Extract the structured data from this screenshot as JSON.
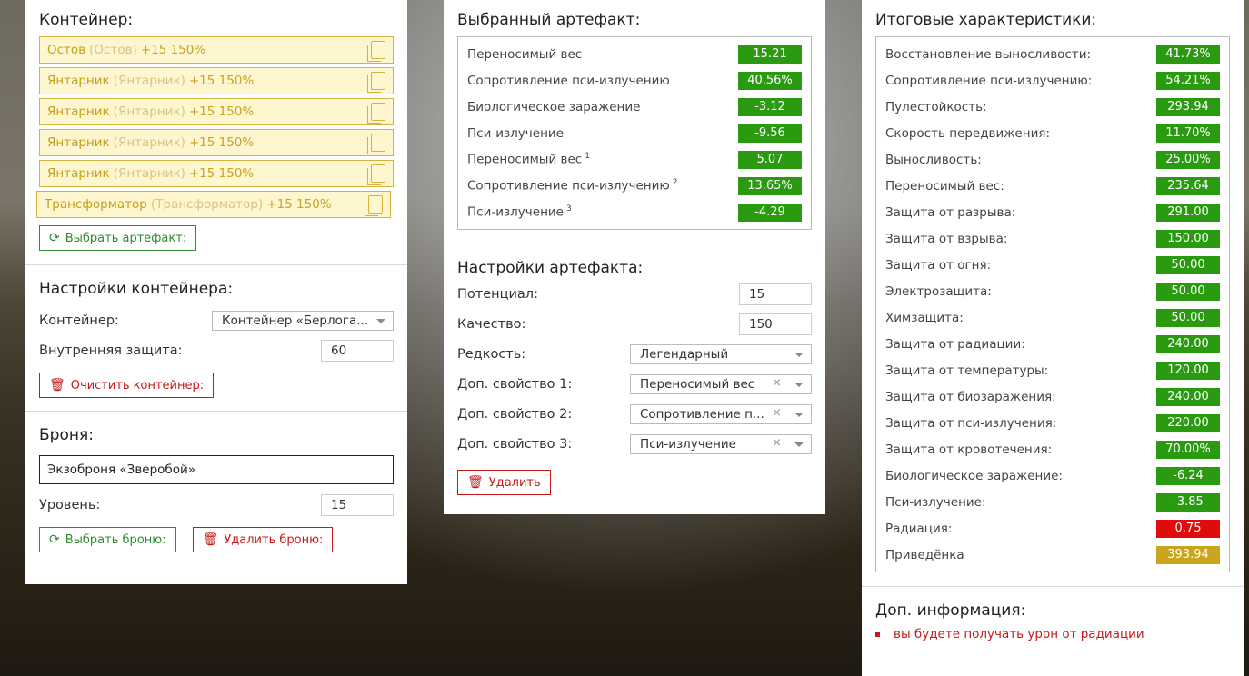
{
  "left": {
    "container_title": "Контейнер:",
    "artifacts": [
      {
        "name": "Остов",
        "sub": "(Остов)",
        "bonus": "+15 150%"
      },
      {
        "name": "Янтарник",
        "sub": "(Янтарник)",
        "bonus": "+15 150%"
      },
      {
        "name": "Янтарник",
        "sub": "(Янтарник)",
        "bonus": "+15 150%"
      },
      {
        "name": "Янтарник",
        "sub": "(Янтарник)",
        "bonus": "+15 150%"
      },
      {
        "name": "Янтарник",
        "sub": "(Янтарник)",
        "bonus": "+15 150%"
      },
      {
        "name": "Трансформатор",
        "sub": "(Трансформатор)",
        "bonus": "+15 150%"
      }
    ],
    "choose_artifact_label": "Выбрать артефакт:",
    "container_settings_title": "Настройки контейнера:",
    "container_label": "Контейнер:",
    "container_value": "Контейнер «Берлога...",
    "inner_protection_label": "Внутренняя защита:",
    "inner_protection_value": "60",
    "clear_container_label": "Очистить контейнер:",
    "armor_title": "Броня:",
    "armor_value": "Экзоброня «Зверобой»",
    "level_label": "Уровень:",
    "level_value": "15",
    "choose_armor_label": "Выбрать броню:",
    "delete_armor_label": "Удалить броню:"
  },
  "mid": {
    "selected_title": "Выбранный артефакт:",
    "stats": [
      {
        "label": "Переносимый вес",
        "sup": "",
        "value": "15.21"
      },
      {
        "label": "Сопротивление пси-излучению",
        "sup": "",
        "value": "40.56%"
      },
      {
        "label": "Биологическое заражение",
        "sup": "",
        "value": "-3.12"
      },
      {
        "label": "Пси-излучение",
        "sup": "",
        "value": "-9.56"
      },
      {
        "label": "Переносимый вес",
        "sup": "1",
        "value": "5.07"
      },
      {
        "label": "Сопротивление пси-излучению",
        "sup": "2",
        "value": "13.65%"
      },
      {
        "label": "Пси-излучение",
        "sup": "3",
        "value": "-4.29"
      }
    ],
    "settings_title": "Настройки артефакта:",
    "potential_label": "Потенциал:",
    "potential_value": "15",
    "quality_label": "Качество:",
    "quality_value": "150",
    "rarity_label": "Редкость:",
    "rarity_value": "Легендарный",
    "extra1_label": "Доп. свойство 1:",
    "extra1_value": "Переносимый вес",
    "extra2_label": "Доп. свойство 2:",
    "extra2_value": "Сопротивление п...",
    "extra3_label": "Доп. свойство 3:",
    "extra3_value": "Пси-излучение",
    "delete_label": "Удалить"
  },
  "right": {
    "totals_title": "Итоговые характеристики:",
    "stats": [
      {
        "label": "Восстановление выносливости:",
        "value": "41.73%",
        "color": "#2a9a11"
      },
      {
        "label": "Сопротивление пси-излучению:",
        "value": "54.21%",
        "color": "#2a9a11"
      },
      {
        "label": "Пулестойкость:",
        "value": "293.94",
        "color": "#2a9a11"
      },
      {
        "label": "Скорость передвижения:",
        "value": "11.70%",
        "color": "#2a9a11"
      },
      {
        "label": "Выносливость:",
        "value": "25.00%",
        "color": "#2a9a11"
      },
      {
        "label": "Переносимый вес:",
        "value": "235.64",
        "color": "#2a9a11"
      },
      {
        "label": "Защита от разрыва:",
        "value": "291.00",
        "color": "#2a9a11"
      },
      {
        "label": "Защита от взрыва:",
        "value": "150.00",
        "color": "#2a9a11"
      },
      {
        "label": "Защита от огня:",
        "value": "50.00",
        "color": "#2a9a11"
      },
      {
        "label": "Электрозащита:",
        "value": "50.00",
        "color": "#2a9a11"
      },
      {
        "label": "Химзащита:",
        "value": "50.00",
        "color": "#2a9a11"
      },
      {
        "label": "Защита от радиации:",
        "value": "240.00",
        "color": "#2a9a11"
      },
      {
        "label": "Защита от температуры:",
        "value": "120.00",
        "color": "#2a9a11"
      },
      {
        "label": "Защита от биозаражения:",
        "value": "240.00",
        "color": "#2a9a11"
      },
      {
        "label": "Защита от пси-излучения:",
        "value": "220.00",
        "color": "#2a9a11"
      },
      {
        "label": "Защита от кровотечения:",
        "value": "70.00%",
        "color": "#2a9a11"
      },
      {
        "label": "Биологическое заражение:",
        "value": "-6.24",
        "color": "#2a9a11"
      },
      {
        "label": "Пси-излучение:",
        "value": "-3.85",
        "color": "#2a9a11"
      },
      {
        "label": "Радиация:",
        "value": "0.75",
        "color": "#e00c0c"
      },
      {
        "label": "Приведёнка",
        "value": "393.94",
        "color": "#c8a51a"
      }
    ],
    "info_title": "Доп. информация:",
    "info_items": [
      "вы будете получать урон от радиации"
    ]
  }
}
